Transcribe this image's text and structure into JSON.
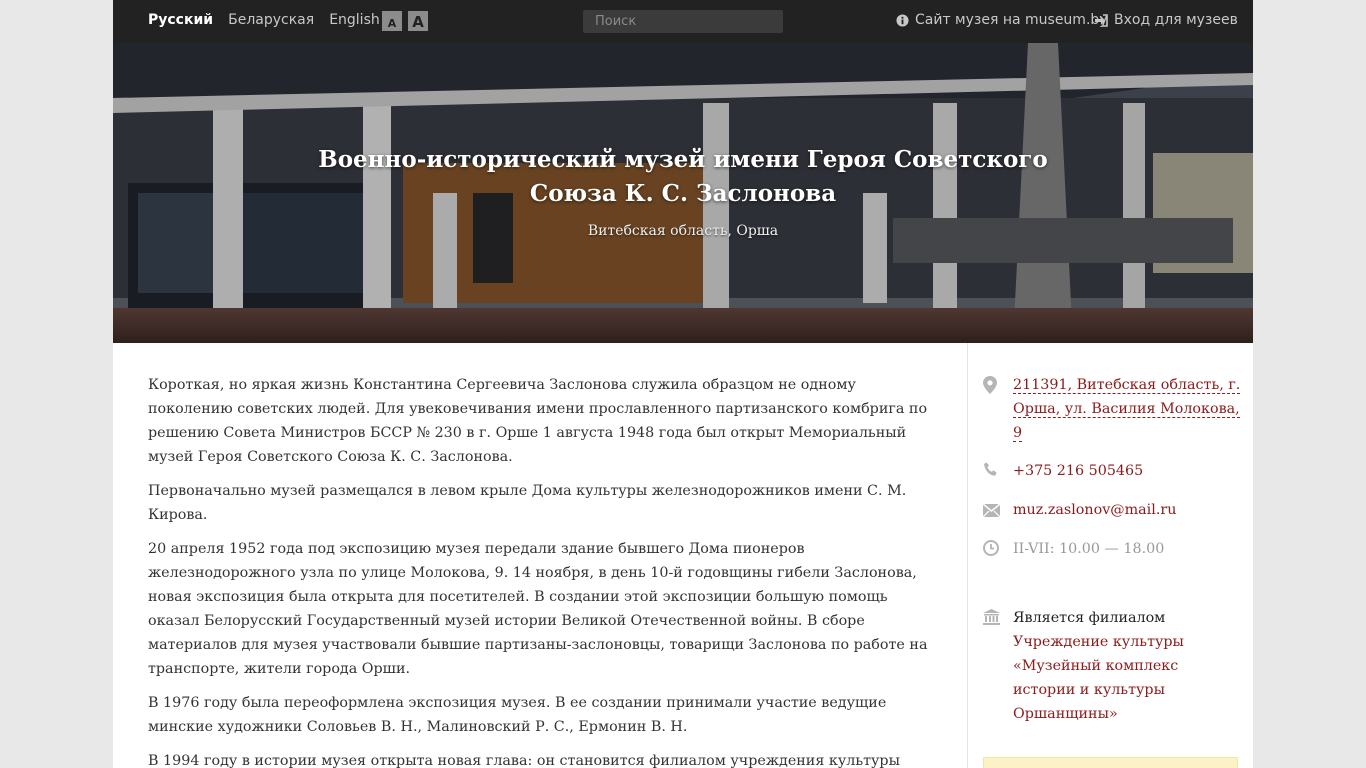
{
  "topbar": {
    "languages": [
      "Русский",
      "Беларуская",
      "English"
    ],
    "active_language": "Русский",
    "font_size_controls": {
      "decrease": "A",
      "increase": "A"
    },
    "search": {
      "placeholder": "Поиск",
      "value": ""
    },
    "site_link": {
      "label": "Сайт музея на museum.by",
      "icon": "info-icon"
    },
    "login_link": {
      "label": "Вход для музеев",
      "icon": "sign-in-icon"
    }
  },
  "hero": {
    "title_line1": "Военно-исторический музей имени Героя Советского",
    "title_line2": "Союза К. С. Заслонова",
    "region": "Витебская область, Орша"
  },
  "main": {
    "paragraphs": [
      "Короткая, но яркая жизнь Константина Сергеевича Заслонова служила образцом не одному поколению советских людей. Для увековечивания имени прославленного партизанского комбрига по решению Совета Министров БССР № 230 в г. Орше 1 августа 1948 года был открыт Мемориальный музей Героя Советского Союза К. С. Заслонова.",
      "Первоначально музей размещался в левом крыле Дома культуры железнодорожников имени С. М. Кирова.",
      "20 апреля 1952 года под экспозицию музея передали здание бывшего Дома пионеров железнодорожного узла по улице Молокова, 9. 14 ноября, в день 10-й годовщины гибели Заслонова, новая экспозиция была открыта для посетителей. В создании этой экспозиции большую помощь оказал Белорусский Государственный музей истории Великой Отечественной войны. В сборе материалов для музея участвовали бывшие партизаны-заслоновцы, товарищи Заслонова по работе на транспорте, жители города Орши.",
      "В 1976 году была переоформлена экспозиция музея. В ее создании принимали участие ведущие минские художники Соловьев В. Н., Малиновский Р. С., Ермонин В. Н.",
      "В 1994 году в истории музея открыта новая глава: он становится филиалом учреждения культуры"
    ]
  },
  "sidebar": {
    "address": {
      "text": "211391, Витебская область, г. Орша, ул. Василия Молокова, 9",
      "icon": "map-pin-icon"
    },
    "phone": {
      "text": "+375 216 505465",
      "icon": "phone-icon"
    },
    "email": {
      "text": "muz.zaslonov@mail.ru",
      "icon": "envelope-icon"
    },
    "hours": {
      "text": "II-VII: 10.00 — 18.00",
      "icon": "clock-icon"
    },
    "branch": {
      "label": "Является филиалом",
      "name": "Учреждение культуры «Музейный комплекс истории и культуры Оршанщины»",
      "icon": "museum-icon"
    }
  },
  "colors": {
    "topbar_bg": "#222222",
    "link": "#8b1a1a",
    "notice_bg": "#fbf3c5"
  }
}
